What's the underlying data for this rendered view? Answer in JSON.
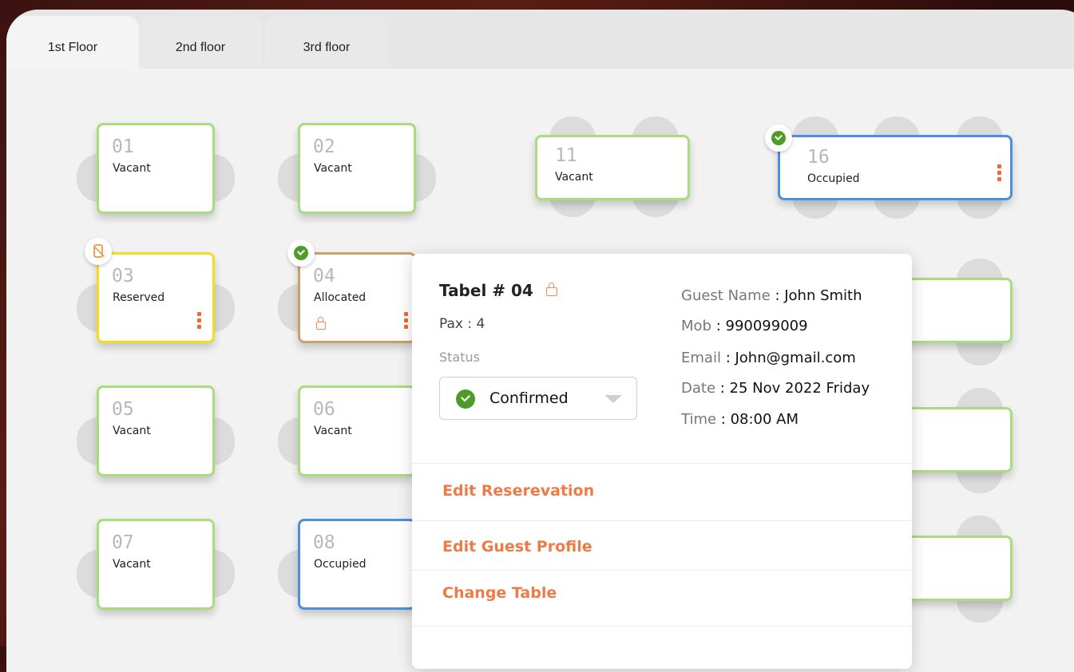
{
  "tabs": [
    "1st Floor",
    "2nd floor",
    "3rd floor"
  ],
  "active_tab": "1st Floor",
  "tables": {
    "t01": {
      "num": "01",
      "status": "Vacant"
    },
    "t02": {
      "num": "02",
      "status": "Vacant"
    },
    "t11": {
      "num": "11",
      "status": "Vacant"
    },
    "t16": {
      "num": "16",
      "status": "Occupied"
    },
    "t03": {
      "num": "03",
      "status": "Reserved"
    },
    "t04": {
      "num": "04",
      "status": "Allocated"
    },
    "t05": {
      "num": "05",
      "status": "Vacant"
    },
    "t06": {
      "num": "06",
      "status": "Vacant"
    },
    "t07": {
      "num": "07",
      "status": "Vacant"
    },
    "t08": {
      "num": "08",
      "status": "Occupied"
    }
  },
  "popup": {
    "title": "Tabel # 04",
    "pax": "Pax : 4",
    "status_label": "Status",
    "status_value": "Confirmed",
    "guest_name_label": "Guest Name",
    "guest_name": ": John Smith",
    "mob_label": "Mob",
    "mob": ":  990099009",
    "email_label": "Email",
    "email": ":  John@gmail.com",
    "date_label": "Date",
    "date": ":  25 Nov 2022 Friday",
    "time_label": "Time",
    "time": ":  08:00 AM",
    "actions": [
      "Edit Reserevation",
      "Edit Guest Profile",
      "Change Table"
    ]
  },
  "colors": {
    "vacant": "#a9dc7c",
    "reserved": "#f4dc22",
    "allocated": "#c9a06a",
    "occupied": "#4a8fe0",
    "accent": "#ee7a45",
    "confirmed": "#4f9b29"
  }
}
